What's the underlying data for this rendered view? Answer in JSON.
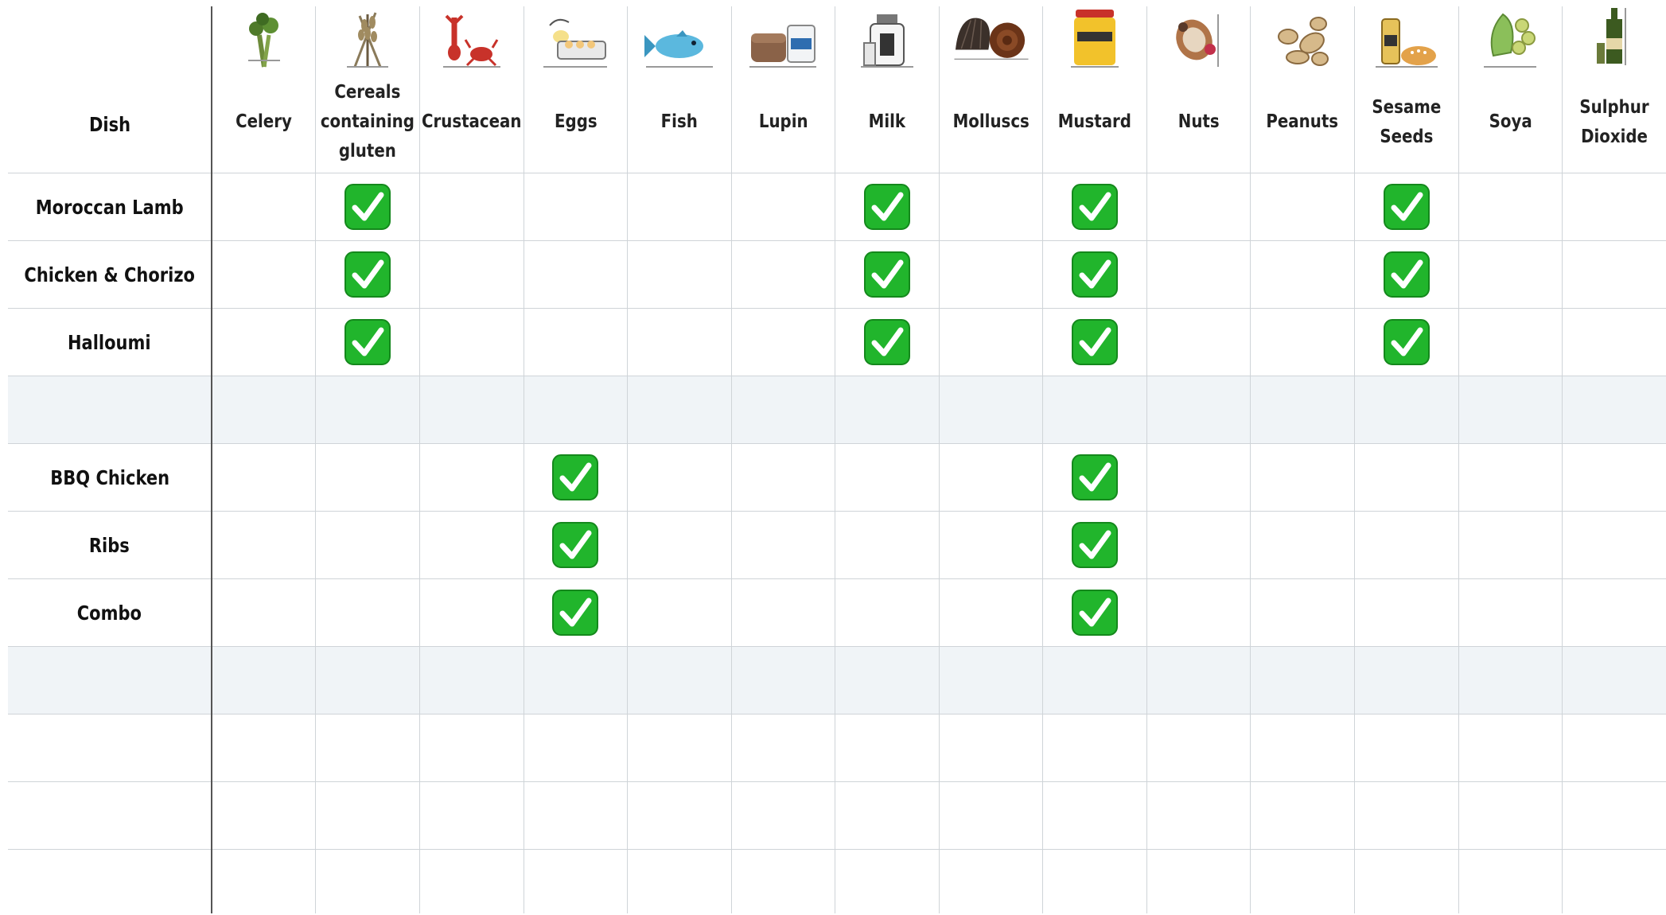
{
  "header": {
    "dish_label": "Dish",
    "allergens": [
      {
        "name": "Celery",
        "icon": "celery-icon"
      },
      {
        "name": "Cereals containing gluten",
        "icon": "wheat-icon"
      },
      {
        "name": "Crustacean",
        "icon": "crab-lobster-icon"
      },
      {
        "name": "Eggs",
        "icon": "egg-carton-icon"
      },
      {
        "name": "Fish",
        "icon": "fish-icon"
      },
      {
        "name": "Lupin",
        "icon": "lupin-bread-icon"
      },
      {
        "name": "Milk",
        "icon": "milk-bottle-icon"
      },
      {
        "name": "Molluscs",
        "icon": "shell-icon"
      },
      {
        "name": "Mustard",
        "icon": "mustard-jar-icon"
      },
      {
        "name": "Nuts",
        "icon": "nuts-icon"
      },
      {
        "name": "Peanuts",
        "icon": "peanuts-icon"
      },
      {
        "name": "Sesame Seeds",
        "icon": "sesame-icon"
      },
      {
        "name": "Soya",
        "icon": "soya-icon"
      },
      {
        "name": "Sulphur Dioxide",
        "icon": "wine-bottle-icon"
      }
    ]
  },
  "rows": [
    {
      "dish": "Moroccan Lamb",
      "checks": [
        false,
        true,
        false,
        false,
        false,
        false,
        true,
        false,
        true,
        false,
        false,
        true,
        false,
        false
      ]
    },
    {
      "dish": "Chicken & Chorizo",
      "checks": [
        false,
        true,
        false,
        false,
        false,
        false,
        true,
        false,
        true,
        false,
        false,
        true,
        false,
        false
      ]
    },
    {
      "dish": "Halloumi",
      "checks": [
        false,
        true,
        false,
        false,
        false,
        false,
        true,
        false,
        true,
        false,
        false,
        true,
        false,
        false
      ]
    },
    {
      "spacer": true
    },
    {
      "dish": "BBQ Chicken",
      "checks": [
        false,
        false,
        false,
        true,
        false,
        false,
        false,
        false,
        true,
        false,
        false,
        false,
        false,
        false
      ]
    },
    {
      "dish": "Ribs",
      "checks": [
        false,
        false,
        false,
        true,
        false,
        false,
        false,
        false,
        true,
        false,
        false,
        false,
        false,
        false
      ]
    },
    {
      "dish": "Combo",
      "checks": [
        false,
        false,
        false,
        true,
        false,
        false,
        false,
        false,
        true,
        false,
        false,
        false,
        false,
        false
      ]
    },
    {
      "spacer": true
    },
    {
      "dish": "",
      "checks": []
    },
    {
      "dish": "",
      "checks": []
    },
    {
      "dish": "",
      "checks": []
    }
  ],
  "colors": {
    "check_green": "#21b52c",
    "grid_line": "#cfd4d8",
    "spacer_bg": "#f0f4f7"
  }
}
